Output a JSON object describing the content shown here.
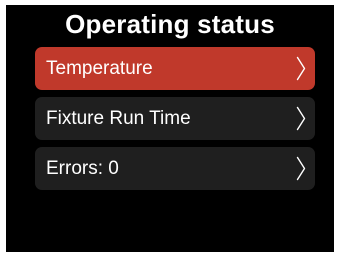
{
  "header": {
    "title": "Operating status"
  },
  "menu": {
    "items": [
      {
        "label": "Temperature",
        "icon": "chevron-right-icon",
        "selected": true
      },
      {
        "label": "Fixture Run Time",
        "icon": "chevron-right-icon",
        "selected": false
      },
      {
        "label": "Errors: 0",
        "icon": "chevron-right-icon",
        "selected": false
      }
    ]
  },
  "colors": {
    "background": "#000000",
    "item_background": "#1f1f1f",
    "selected_background": "#c0392b",
    "text": "#ffffff"
  }
}
